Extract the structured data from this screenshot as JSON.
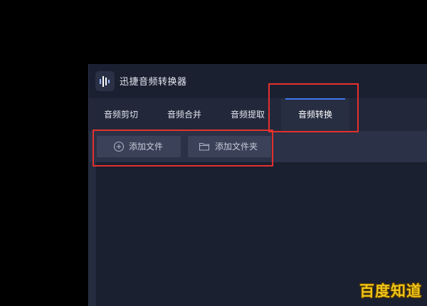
{
  "app": {
    "title": "迅捷音频转换器",
    "logo_icon": "audio-waveform-icon"
  },
  "tabs": [
    {
      "label": "音频剪切",
      "active": false
    },
    {
      "label": "音频合并",
      "active": false
    },
    {
      "label": "音频提取",
      "active": false
    },
    {
      "label": "音频转换",
      "active": true
    }
  ],
  "toolbar": {
    "add_file": {
      "label": "添加文件",
      "icon": "plus-circle-icon"
    },
    "add_folder": {
      "label": "添加文件夹",
      "icon": "folder-icon"
    }
  },
  "watermark": {
    "text": "百度知道"
  },
  "colors": {
    "accent": "#3e78f0",
    "highlight_border": "#e5302f",
    "watermark": "#f0c419"
  }
}
